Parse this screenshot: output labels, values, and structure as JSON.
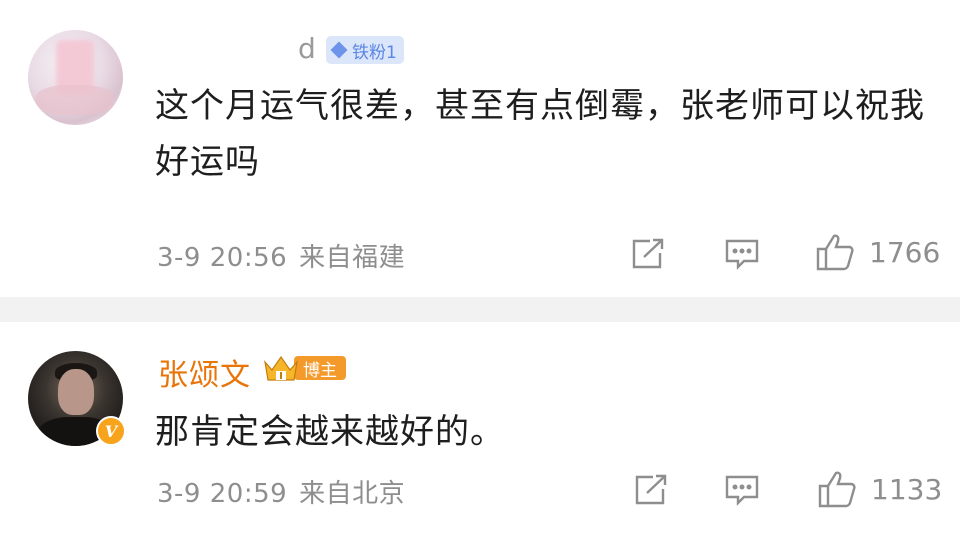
{
  "comments": [
    {
      "username_visible": "d",
      "badge": "铁粉1",
      "text": "这个月运气很差，甚至有点倒霉，张老师可以祝我好运吗",
      "date": "3-9 20:56",
      "location": "来自福建",
      "likes": "1766"
    },
    {
      "username_visible": "张颂文",
      "badge": "博主",
      "verified_mark": "V",
      "text": "那肯定会越来越好的。",
      "date": "3-9 20:59",
      "location": "来自北京",
      "likes": "1133"
    }
  ],
  "colors": {
    "author_name": "#e8740a",
    "blogger_badge": "#f39a2b",
    "fan_badge_bg": "#dbe6fb",
    "fan_badge_text": "#5b86e5",
    "meta_text": "#8e8e8e",
    "separator": "#f2f2f2"
  },
  "icons": [
    "share-icon",
    "comment-icon",
    "like-icon",
    "crown-icon",
    "diamond-icon"
  ]
}
